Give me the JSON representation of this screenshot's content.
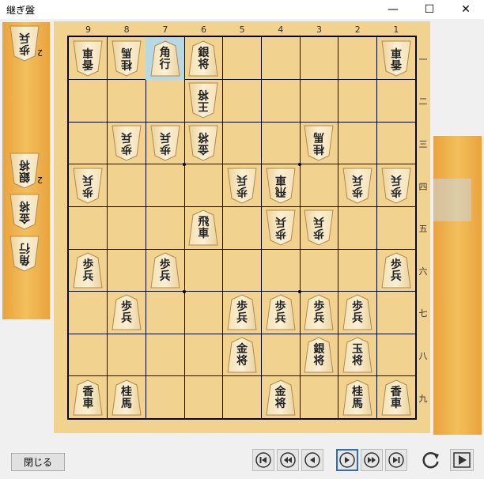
{
  "window": {
    "title": "継ぎ盤",
    "minimize": "—",
    "maximize": "☐",
    "close": "✕"
  },
  "file_labels": [
    "9",
    "8",
    "7",
    "6",
    "5",
    "4",
    "3",
    "2",
    "1"
  ],
  "rank_labels": [
    "一",
    "二",
    "三",
    "四",
    "五",
    "六",
    "七",
    "八",
    "九"
  ],
  "board": {
    "highlight_square": "7一",
    "pieces": [
      {
        "sq": "9一",
        "l1": "香",
        "l2": "車",
        "side": "gote"
      },
      {
        "sq": "8一",
        "l1": "桂",
        "l2": "馬",
        "side": "gote"
      },
      {
        "sq": "7一",
        "l1": "角",
        "l2": "行",
        "side": "sente"
      },
      {
        "sq": "6一",
        "l1": "銀",
        "l2": "将",
        "side": "sente"
      },
      {
        "sq": "1一",
        "l1": "香",
        "l2": "車",
        "side": "gote"
      },
      {
        "sq": "6二",
        "l1": "王",
        "l2": "将",
        "side": "gote"
      },
      {
        "sq": "8三",
        "l1": "歩",
        "l2": "兵",
        "side": "gote"
      },
      {
        "sq": "7三",
        "l1": "歩",
        "l2": "兵",
        "side": "gote"
      },
      {
        "sq": "6三",
        "l1": "金",
        "l2": "将",
        "side": "gote"
      },
      {
        "sq": "3三",
        "l1": "桂",
        "l2": "馬",
        "side": "gote"
      },
      {
        "sq": "9四",
        "l1": "歩",
        "l2": "兵",
        "side": "gote"
      },
      {
        "sq": "5四",
        "l1": "歩",
        "l2": "兵",
        "side": "gote"
      },
      {
        "sq": "4四",
        "l1": "飛",
        "l2": "車",
        "side": "gote"
      },
      {
        "sq": "2四",
        "l1": "歩",
        "l2": "兵",
        "side": "gote"
      },
      {
        "sq": "1四",
        "l1": "歩",
        "l2": "兵",
        "side": "gote"
      },
      {
        "sq": "6五",
        "l1": "飛",
        "l2": "車",
        "side": "sente"
      },
      {
        "sq": "4五",
        "l1": "歩",
        "l2": "兵",
        "side": "gote"
      },
      {
        "sq": "3五",
        "l1": "歩",
        "l2": "兵",
        "side": "gote"
      },
      {
        "sq": "9六",
        "l1": "歩",
        "l2": "兵",
        "side": "sente"
      },
      {
        "sq": "7六",
        "l1": "歩",
        "l2": "兵",
        "side": "sente"
      },
      {
        "sq": "1六",
        "l1": "歩",
        "l2": "兵",
        "side": "sente"
      },
      {
        "sq": "8七",
        "l1": "歩",
        "l2": "兵",
        "side": "sente"
      },
      {
        "sq": "5七",
        "l1": "歩",
        "l2": "兵",
        "side": "sente"
      },
      {
        "sq": "4七",
        "l1": "歩",
        "l2": "兵",
        "side": "sente"
      },
      {
        "sq": "3七",
        "l1": "歩",
        "l2": "兵",
        "side": "sente"
      },
      {
        "sq": "2七",
        "l1": "歩",
        "l2": "兵",
        "side": "sente"
      },
      {
        "sq": "5八",
        "l1": "金",
        "l2": "将",
        "side": "sente"
      },
      {
        "sq": "3八",
        "l1": "銀",
        "l2": "将",
        "side": "sente"
      },
      {
        "sq": "2八",
        "l1": "玉",
        "l2": "将",
        "side": "sente"
      },
      {
        "sq": "9九",
        "l1": "香",
        "l2": "車",
        "side": "sente"
      },
      {
        "sq": "8九",
        "l1": "桂",
        "l2": "馬",
        "side": "sente"
      },
      {
        "sq": "4九",
        "l1": "金",
        "l2": "将",
        "side": "sente"
      },
      {
        "sq": "2九",
        "l1": "桂",
        "l2": "馬",
        "side": "sente"
      },
      {
        "sq": "1九",
        "l1": "香",
        "l2": "車",
        "side": "sente"
      }
    ]
  },
  "gote_hand": [
    {
      "l1": "歩",
      "l2": "兵",
      "count": "2"
    },
    {
      "l1": "銀",
      "l2": "将",
      "count": "2"
    },
    {
      "l1": "金",
      "l2": "将",
      "count": ""
    },
    {
      "l1": "角",
      "l2": "行",
      "count": ""
    }
  ],
  "sente_hand": [],
  "buttons": {
    "close_label": "閉じる"
  },
  "nav": [
    "first",
    "back-many",
    "back",
    "forward",
    "forward-many",
    "last",
    "flip",
    "play"
  ]
}
